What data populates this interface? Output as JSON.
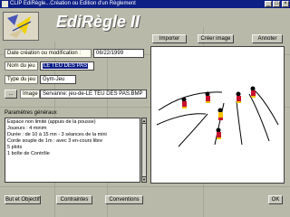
{
  "window": {
    "title": "CLIP EdiRègle...Création ou Edition d'un Règlement",
    "controls": [
      "_",
      "□",
      "×"
    ]
  },
  "header": {
    "app_name": "EdiRègle II"
  },
  "toolbar": {
    "import_label": "Importer",
    "create_image_label": "Créer image",
    "annotate_label": "Annoter"
  },
  "form": {
    "date_label": "Date création ou modification :",
    "date_value": "06/22/1999",
    "game_name_label": "Nom du jeu :",
    "game_name_value": "LE TEU DES PAS",
    "game_type_label": "Type du jeu :",
    "game_type_value": "Gym-Jeu",
    "image_browse_label": "...",
    "image_label": "Image :",
    "image_value": "Servanne: jeu-de-LE TEU DES PAS.BMP"
  },
  "parameters": {
    "title": "Paramètres généraux",
    "lines": [
      "Espace non limité (appuis de la pousse)",
      "Joueurs : 4 minim",
      "Durée : de 10 à 15 mn - 3 séances de la mini",
      "Corde souple de 1m : avec 3 en-cours libre",
      "5 plots",
      "1 boîte de Contrôle"
    ]
  },
  "footer": {
    "objectives_label": "But et Objectifs",
    "constraints_label": "Contraintes",
    "conventions_label": "Conventions",
    "ok_label": "OK"
  },
  "colors": {
    "titlebar": "#0e1f86",
    "window_bg": "#b9b9a9",
    "figure_red": "#c8102e",
    "figure_yellow": "#f2c200"
  }
}
